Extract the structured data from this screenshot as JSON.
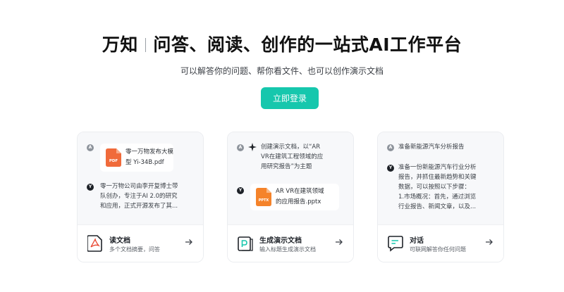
{
  "hero": {
    "brand": "万知",
    "headline": "问答、阅读、创作的一站式AI工作平台",
    "subtitle": "可以解答你的问题、帮你看文件、也可以创作演示文档",
    "login_label": "立即登录"
  },
  "cards": [
    {
      "file_name_line1": "零一万物发布大模",
      "file_name_line2": "型 Yi-34B.pdf",
      "ai_line1": "零一万物公司由李开复博士带",
      "ai_line2": "队创办，专注于AI 2.0的研究",
      "ai_line3": "和应用，正式开源发布了其...",
      "feature_title": "读文档",
      "feature_desc": "多个文档摘要，问答"
    },
    {
      "user_line1": "创建演示文档，以“AR",
      "user_line2": "VR在建筑工程领域的应",
      "user_line3": "用研究报告”为主题",
      "file_name_line1": "AR VR在建筑领域",
      "file_name_line2": "的应用报告.pptx",
      "feature_title": "生成演示文档",
      "feature_desc": "输入标题生成演示文档"
    },
    {
      "user_line1": "准备新能源汽车分析报告",
      "ai_line1": "准备一份新能源汽车行业分析",
      "ai_line2": "报告，并抓住最新趋势和关键",
      "ai_line3": "数据，可以按照以下步骤：",
      "ai_line4": "1.市场概况：首先，通过浏览",
      "ai_line5": "行业报告、新闻文章，以及...",
      "feature_title": "对话",
      "feature_desc": "可联网解答你任何问题"
    }
  ],
  "colors": {
    "accent": "#16c7ad",
    "pdf_icon": "#f06a3a",
    "ppt_icon": "#f5832a"
  }
}
